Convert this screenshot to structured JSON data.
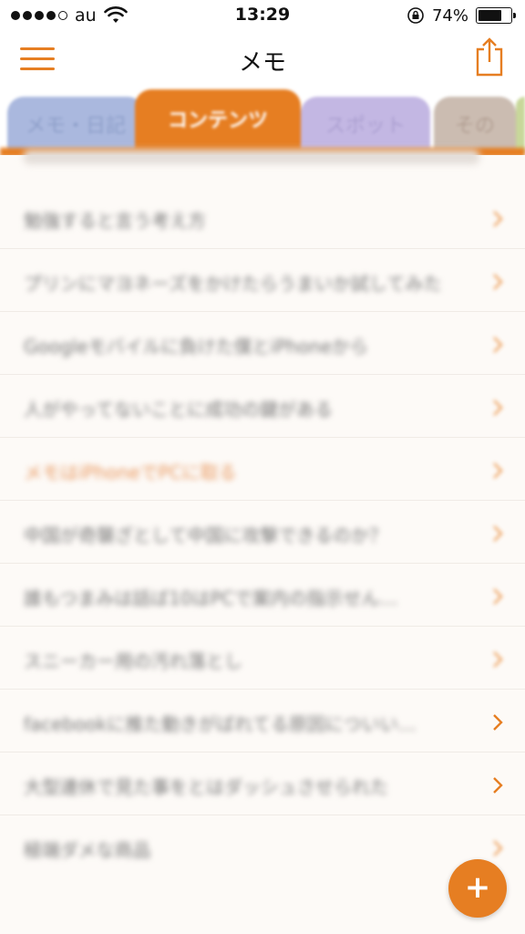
{
  "status_bar": {
    "carrier": "au",
    "time": "13:29",
    "battery_percent": "74%",
    "battery_level": 0.74,
    "signal_bars_filled": 4,
    "icons": [
      "wifi-icon",
      "rotation-lock-icon",
      "battery-icon"
    ]
  },
  "nav": {
    "title": "メモ",
    "icons": [
      "menu-icon",
      "share-icon"
    ]
  },
  "tabs": [
    {
      "label": "メモ・日記"
    },
    {
      "label": "コンテンツ"
    },
    {
      "label": "スポット"
    },
    {
      "label": "その"
    }
  ],
  "list": {
    "items": [
      {
        "text": "勉強すると言う考え方"
      },
      {
        "text": "プリンにマヨネーズをかけたらうまいか試してみた"
      },
      {
        "text": "Googleモバイルに負けた僕とiPhoneから"
      },
      {
        "text": "人がやってないことに成功の鍵がある"
      },
      {
        "text": "メモはiPhoneでPCに取る"
      },
      {
        "text": "中国が奇襲ざとして中国に攻撃できるのか？"
      },
      {
        "text": "誰もつまみは話ば10はPCで案内の指示せん…"
      },
      {
        "text": "スニーカー用の汚れ落とし"
      },
      {
        "text": "facebookに推た動きがばれてる原因についい…"
      },
      {
        "text": "大型連休で見た事をとはダッシュさせられた"
      },
      {
        "text": "極端ダメな商品"
      }
    ]
  },
  "colors": {
    "accent": "#e67e22",
    "tab_memo": "#aab8de",
    "tab_spot": "#c3b7e3",
    "tab_other": "#cbbcb1"
  },
  "fab": {
    "label": "+"
  }
}
